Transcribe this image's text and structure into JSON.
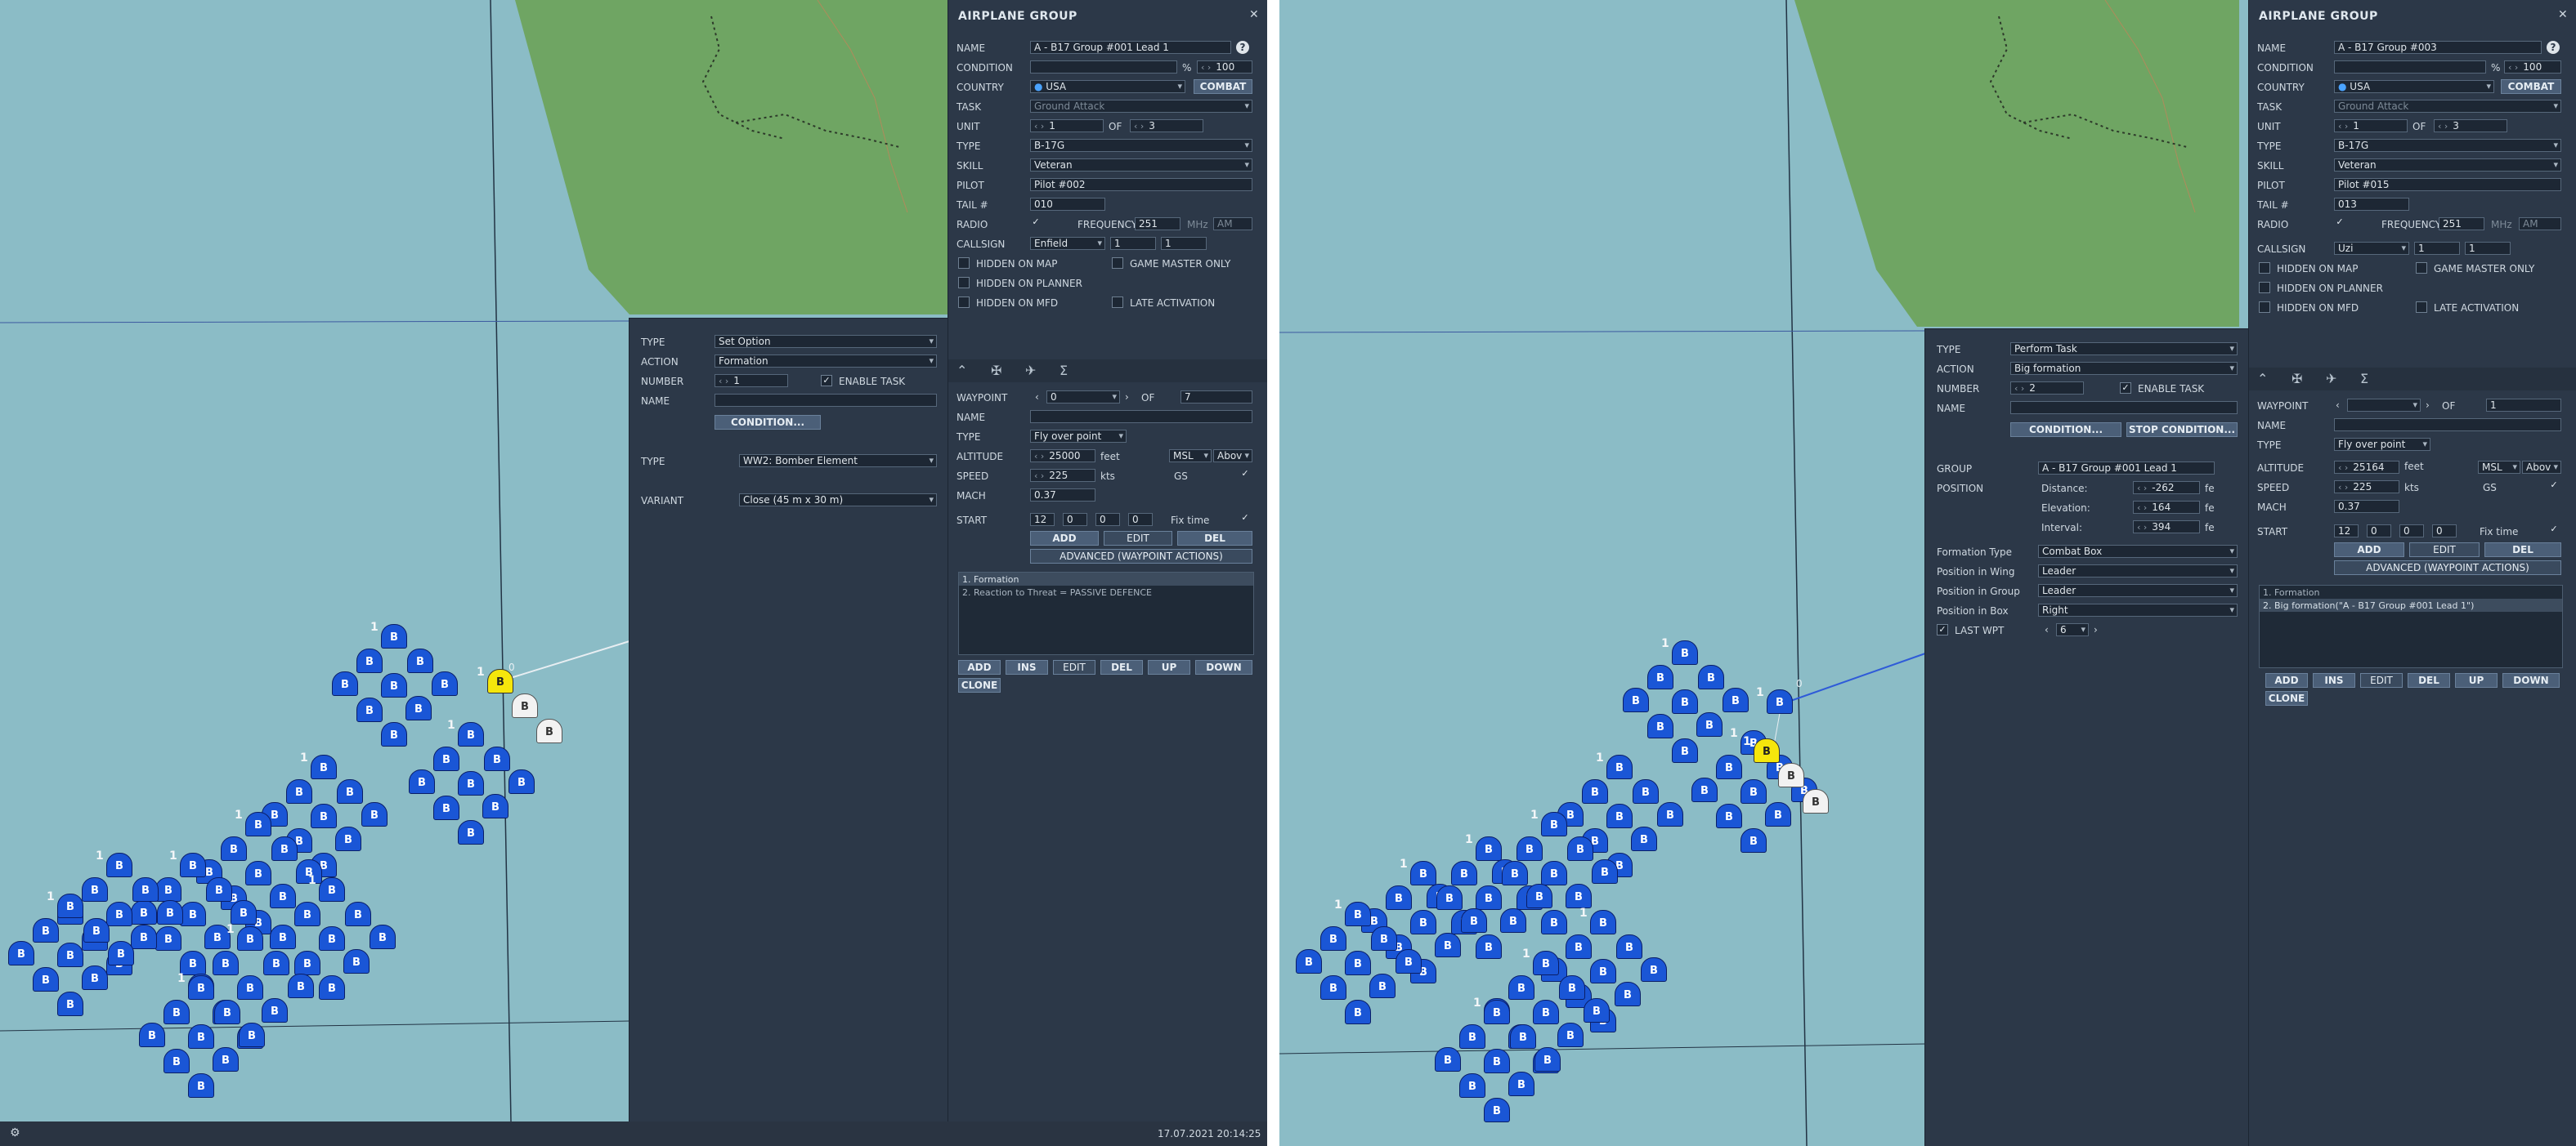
{
  "left": {
    "group_panel": {
      "title": "AIRPLANE GROUP",
      "close_icon": "close-icon",
      "name_label": "NAME",
      "name_value": "A - B17 Group #001 Lead 1",
      "condition_label": "CONDITION",
      "condition_pct": "%",
      "condition_value": "100",
      "country_label": "COUNTRY",
      "country_value": "USA",
      "combat_label": "COMBAT",
      "task_label": "TASK",
      "task_value": "Ground Attack",
      "unit_label": "UNIT",
      "unit_value": "1",
      "unit_of": "OF",
      "unit_total": "3",
      "type_label": "TYPE",
      "type_value": "B-17G",
      "skill_label": "SKILL",
      "skill_value": "Veteran",
      "pilot_label": "PILOT",
      "pilot_value": "Pilot #002",
      "tail_label": "TAIL #",
      "tail_value": "010",
      "radio_label": "RADIO",
      "frequency_label": "FREQUENCY",
      "frequency_value": "251",
      "mhz": "MHz",
      "am": "AM",
      "callsign_label": "CALLSIGN",
      "callsign_value": "Enfield",
      "callsign_n1": "1",
      "callsign_n2": "1",
      "hidden_map": "HIDDEN ON MAP",
      "gm_only": "GAME MASTER ONLY",
      "hidden_planner": "HIDDEN ON PLANNER",
      "hidden_mfd": "HIDDEN ON MFD",
      "late_activation": "LATE ACTIVATION"
    },
    "waypoint_panel": {
      "waypoint_label": "WAYPOINT",
      "waypoint_value": "0",
      "of_label": "OF",
      "waypoint_total": "7",
      "name_label": "NAME",
      "type_label": "TYPE",
      "type_value": "Fly over point",
      "altitude_label": "ALTITUDE",
      "altitude_value": "25000",
      "altitude_unit": "feet",
      "msl": "MSL",
      "above": "Abov",
      "speed_label": "SPEED",
      "speed_value": "225",
      "speed_unit": "kts",
      "gs": "GS",
      "mach_label": "MACH",
      "mach_value": "0.37",
      "start_label": "START",
      "start_h": "12",
      "start_m": "0",
      "start_s": "0",
      "start_x": "0",
      "fixtime": "Fix time",
      "add": "ADD",
      "edit": "EDIT",
      "del": "DEL",
      "advanced": "ADVANCED (WAYPOINT ACTIONS)",
      "actions": [
        "1. Formation",
        "2. Reaction to Threat = PASSIVE DEFENCE"
      ],
      "btn_add": "ADD",
      "btn_ins": "INS",
      "btn_edit": "EDIT",
      "btn_del": "DEL",
      "btn_up": "UP",
      "btn_down": "DOWN",
      "btn_clone": "CLONE"
    },
    "action_panel": {
      "type_label": "TYPE",
      "type_value": "Set Option",
      "action_label": "ACTION",
      "action_value": "Formation",
      "number_label": "NUMBER",
      "number_value": "1",
      "enable_task": "ENABLE TASK",
      "name_label": "NAME",
      "condition_btn": "CONDITION...",
      "type2_label": "TYPE",
      "type2_value": "WW2: Bomber Element",
      "variant_label": "VARIANT",
      "variant_value": "Close (45 m x 30 m)"
    },
    "status": {
      "datetime": "17.07.2021 20:14:25"
    }
  },
  "right": {
    "group_panel": {
      "title": "AIRPLANE GROUP",
      "name_label": "NAME",
      "name_value": "A - B17 Group #003",
      "condition_label": "CONDITION",
      "condition_pct": "%",
      "condition_value": "100",
      "country_label": "COUNTRY",
      "country_value": "USA",
      "combat_label": "COMBAT",
      "task_label": "TASK",
      "task_value": "Ground Attack",
      "unit_label": "UNIT",
      "unit_value": "1",
      "unit_of": "OF",
      "unit_total": "3",
      "type_label": "TYPE",
      "type_value": "B-17G",
      "skill_label": "SKILL",
      "skill_value": "Veteran",
      "pilot_label": "PILOT",
      "pilot_value": "Pilot #015",
      "tail_label": "TAIL #",
      "tail_value": "013",
      "radio_label": "RADIO",
      "frequency_label": "FREQUENCY",
      "frequency_value": "251",
      "mhz": "MHz",
      "am": "AM",
      "callsign_label": "CALLSIGN",
      "callsign_value": "Uzi",
      "callsign_n1": "1",
      "callsign_n2": "1",
      "hidden_map": "HIDDEN ON MAP",
      "gm_only": "GAME MASTER ONLY",
      "hidden_planner": "HIDDEN ON PLANNER",
      "hidden_mfd": "HIDDEN ON MFD",
      "late_activation": "LATE ACTIVATION"
    },
    "waypoint_panel": {
      "waypoint_label": "WAYPOINT",
      "waypoint_value": "",
      "of_label": "OF",
      "waypoint_total": "1",
      "name_label": "NAME",
      "type_label": "TYPE",
      "type_value": "Fly over point",
      "altitude_label": "ALTITUDE",
      "altitude_value": "25164",
      "altitude_unit": "feet",
      "msl": "MSL",
      "above": "Abov",
      "speed_label": "SPEED",
      "speed_value": "225",
      "speed_unit": "kts",
      "gs": "GS",
      "mach_label": "MACH",
      "mach_value": "0.37",
      "start_label": "START",
      "start_h": "12",
      "start_m": "0",
      "start_s": "0",
      "start_x": "0",
      "fixtime": "Fix time",
      "add": "ADD",
      "edit": "EDIT",
      "del": "DEL",
      "advanced": "ADVANCED (WAYPOINT ACTIONS)",
      "actions": [
        "1. Formation",
        "2. Big formation(\"A - B17 Group #001 Lead 1\")"
      ],
      "btn_add": "ADD",
      "btn_ins": "INS",
      "btn_edit": "EDIT",
      "btn_del": "DEL",
      "btn_up": "UP",
      "btn_down": "DOWN",
      "btn_clone": "CLONE"
    },
    "action_panel": {
      "type_label": "TYPE",
      "type_value": "Perform Task",
      "action_label": "ACTION",
      "action_value": "Big formation",
      "number_label": "NUMBER",
      "number_value": "2",
      "enable_task": "ENABLE TASK",
      "name_label": "NAME",
      "condition_btn": "CONDITION...",
      "stop_condition_btn": "STOP CONDITION...",
      "group_label": "GROUP",
      "group_value": "A - B17 Group #001 Lead 1",
      "position_label": "POSITION",
      "distance_label": "Distance:",
      "distance_value": "-262",
      "distance_unit": "fe",
      "elevation_label": "Elevation:",
      "elevation_value": "164",
      "elevation_unit": "fe",
      "interval_label": "Interval:",
      "interval_value": "394",
      "interval_unit": "fe",
      "formation_type_label": "Formation Type",
      "formation_type_value": "Combat Box",
      "pos_wing_label": "Position in Wing",
      "pos_wing_value": "Leader",
      "pos_group_label": "Position in Group",
      "pos_group_value": "Leader",
      "pos_box_label": "Position in Box",
      "pos_box_value": "Right",
      "last_wpt": "LAST WPT",
      "last_wpt_value": "6"
    }
  },
  "map": {
    "plane_letter": "B",
    "plane_lead_number": "1",
    "waypoint_number": "0",
    "colors": {
      "water": "#8bbcc6",
      "land": "#6fa563",
      "friendly": "#1a56d6",
      "selected": "#f5e60c",
      "panel": "#2c3848"
    }
  }
}
